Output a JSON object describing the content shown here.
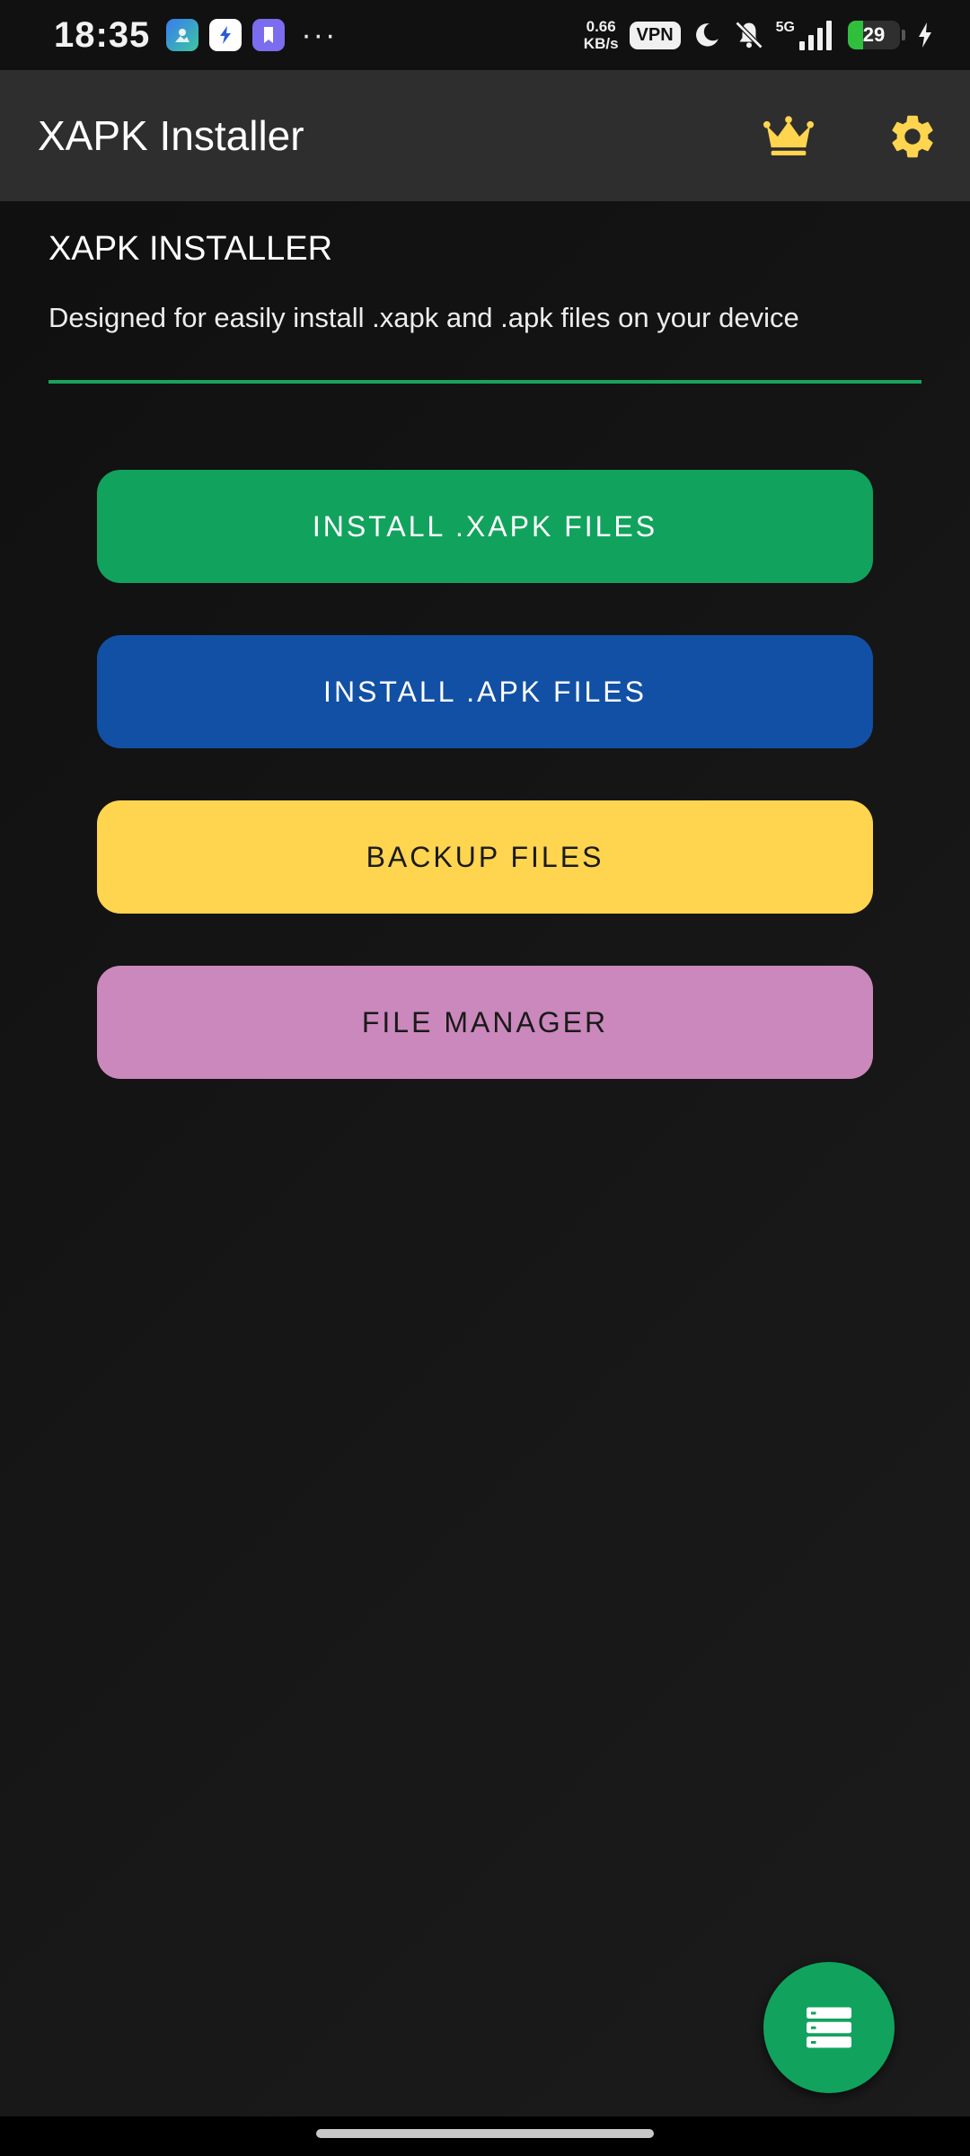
{
  "status_bar": {
    "time": "18:35",
    "more": "···",
    "speed_value": "0.66",
    "speed_unit": "KB/s",
    "vpn": "VPN",
    "network": "5G",
    "battery_level": 29,
    "battery_text": "29",
    "battery_color": "#2fbf3c"
  },
  "app_bar": {
    "title": "XAPK Installer"
  },
  "header": {
    "title": "XAPK INSTALLER",
    "subtitle": "Designed for easily install .xapk and .apk files on your device"
  },
  "buttons": [
    {
      "label": "INSTALL .XAPK FILES",
      "bg": "#11a35d",
      "fg": "#ffffff"
    },
    {
      "label": "INSTALL .APK FILES",
      "bg": "#1150a4",
      "fg": "#ffffff"
    },
    {
      "label": "BACKUP FILES",
      "bg": "#ffd44f",
      "fg": "#1a1a1a"
    },
    {
      "label": "FILE MANAGER",
      "bg": "#cb88bc",
      "fg": "#1a1a1a"
    }
  ],
  "colors": {
    "accent": "#1aa25c",
    "icon_yellow": "#ffd44f",
    "fab": "#11a35d"
  },
  "icons": {
    "crown": "crown-icon",
    "settings": "gear-icon",
    "fab": "list-icon"
  }
}
